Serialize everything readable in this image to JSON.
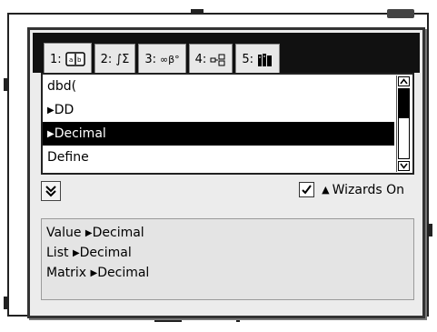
{
  "tabs": [
    {
      "num": "1:",
      "icon": "catalog-book-icon",
      "active": true
    },
    {
      "num": "2:",
      "icon": "math-integral-sigma-icon",
      "symbol": "∫Σ"
    },
    {
      "num": "3:",
      "icon": "units-symbols-icon",
      "symbol": "∞β°"
    },
    {
      "num": "4:",
      "icon": "templates-icon"
    },
    {
      "num": "5:",
      "icon": "libraries-icon"
    }
  ],
  "list": {
    "items": [
      {
        "text": "dbd("
      },
      {
        "arrow": "▶",
        "text": "DD"
      },
      {
        "arrow": "▶",
        "text": "Decimal",
        "selected": true
      },
      {
        "text": "Define"
      }
    ]
  },
  "wizards": {
    "checked": true,
    "arrow": "▲",
    "label": "Wizards On"
  },
  "help": {
    "lines": [
      {
        "prefix": "Value ",
        "arrow": "▶",
        "suffix": "Decimal"
      },
      {
        "prefix": "List ",
        "arrow": "▶",
        "suffix": "Decimal"
      },
      {
        "prefix": "Matrix ",
        "arrow": "▶",
        "suffix": "Decimal"
      }
    ]
  },
  "colors": {
    "selected_bg": "#000000",
    "dialog_bg": "#ececec",
    "help_bg": "#e4e4e4"
  }
}
